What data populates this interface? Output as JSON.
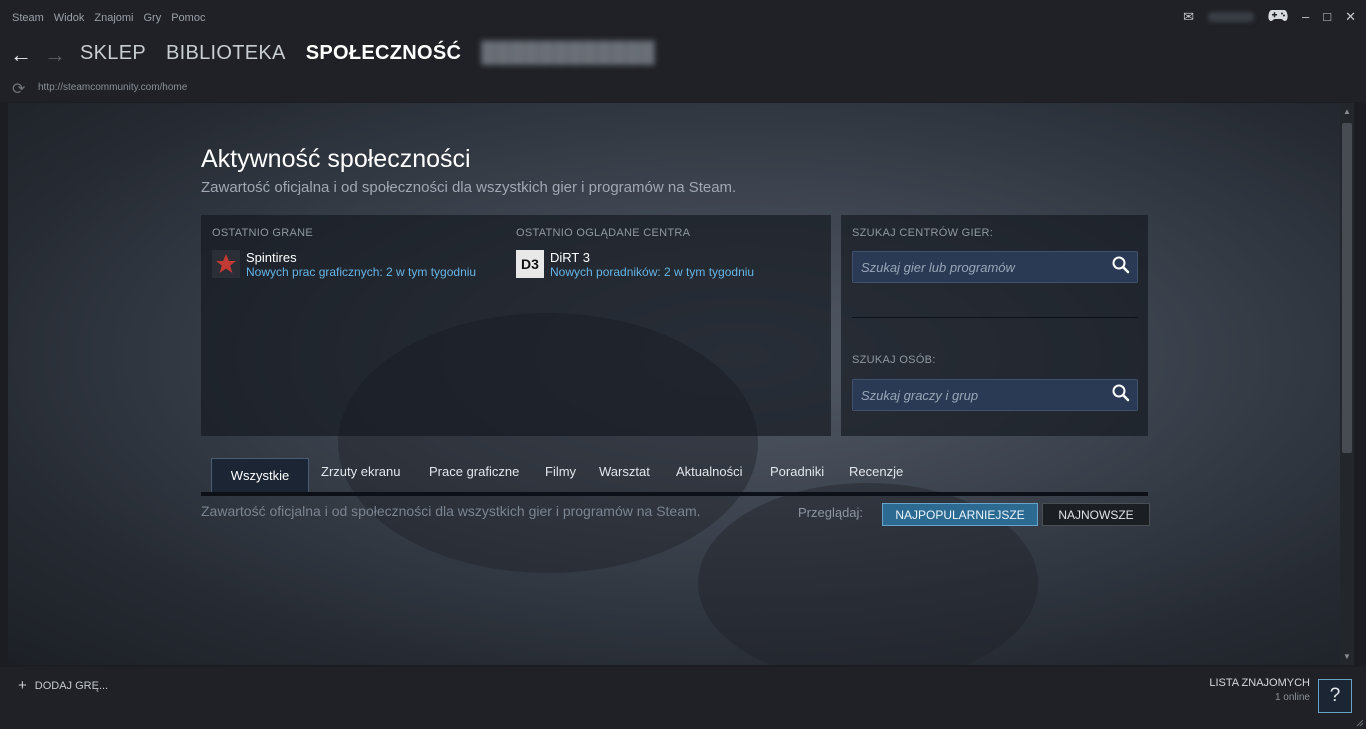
{
  "menu": [
    "Steam",
    "Widok",
    "Znajomi",
    "Gry",
    "Pomoc"
  ],
  "nav": {
    "tabs": [
      "SKLEP",
      "BIBLIOTEKA",
      "SPOŁECZNOŚĆ"
    ],
    "active": "SPOŁECZNOŚĆ"
  },
  "url": "http://steamcommunity.com/home",
  "page": {
    "title": "Aktywność społeczności",
    "subtitle": "Zawartość oficjalna i od społeczności dla wszystkich gier i programów na Steam."
  },
  "recent": {
    "played_label": "OSTATNIO GRANE",
    "viewed_label": "OSTATNIO OGLĄDANE CENTRA",
    "played": {
      "name": "Spintires",
      "link": "Nowych prac graficznych: 2 w tym tygodniu"
    },
    "viewed": {
      "name": "DiRT 3",
      "link": "Nowych poradników: 2 w tym tygodniu",
      "icon_text": "D3"
    }
  },
  "search": {
    "hubs_label": "SZUKAJ CENTRÓW GIER:",
    "hubs_placeholder": "Szukaj gier lub programów",
    "people_label": "SZUKAJ OSÓB:",
    "people_placeholder": "Szukaj graczy i grup"
  },
  "content_tabs": [
    "Wszystkie",
    "Zrzuty ekranu",
    "Prace graficzne",
    "Filmy",
    "Warsztat",
    "Aktualności",
    "Poradniki",
    "Recenzje"
  ],
  "content_desc": "Zawartość oficjalna i od społeczności dla wszystkich gier i programów na Steam.",
  "browse": {
    "label": "Przeglądaj:",
    "popular": "NAJPOPULARNIEJSZE",
    "newest": "NAJNOWSZE"
  },
  "footer": {
    "add_game": "DODAJ GRĘ...",
    "friends": "LISTA ZNAJOMYCH",
    "online": "1 online",
    "help": "?"
  },
  "colors": {
    "accent": "#66b4e6",
    "button_active": "#2c6a92"
  }
}
